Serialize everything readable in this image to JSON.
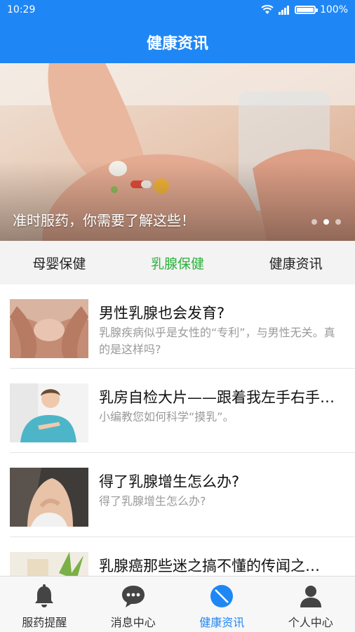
{
  "status_bar": {
    "time": "10:29",
    "battery": "100%"
  },
  "header": {
    "title": "健康资讯"
  },
  "banner": {
    "caption": "准时服药，你需要了解这些！",
    "page_count": 3,
    "active_page": 1
  },
  "category_tabs": [
    {
      "label": "母婴保健",
      "active": false
    },
    {
      "label": "乳腺保健",
      "active": true
    },
    {
      "label": "健康资讯",
      "active": false
    }
  ],
  "articles": [
    {
      "title": "男性乳腺也会发育?",
      "summary": "乳腺疾病似乎是女性的“专利”，与男性无关。真的是这样吗?"
    },
    {
      "title": "乳房自检大片——跟着我左手右手…",
      "summary": "小编教您如何科学“摸乳”。"
    },
    {
      "title": "得了乳腺增生怎么办?",
      "summary": "得了乳腺增生怎么办?"
    },
    {
      "title": "乳腺癌那些迷之搞不懂的传闻之…",
      "summary": ""
    }
  ],
  "bottom_nav": [
    {
      "label": "服药提醒",
      "icon": "bell-icon",
      "active": false
    },
    {
      "label": "消息中心",
      "icon": "chat-bubble-icon",
      "active": false
    },
    {
      "label": "健康资讯",
      "icon": "health-news-icon",
      "active": true
    },
    {
      "label": "个人中心",
      "icon": "person-icon",
      "active": false
    }
  ],
  "colors": {
    "primary": "#1f87f5",
    "tab_active": "#2bb13c",
    "muted_text": "#9a9a9a"
  }
}
